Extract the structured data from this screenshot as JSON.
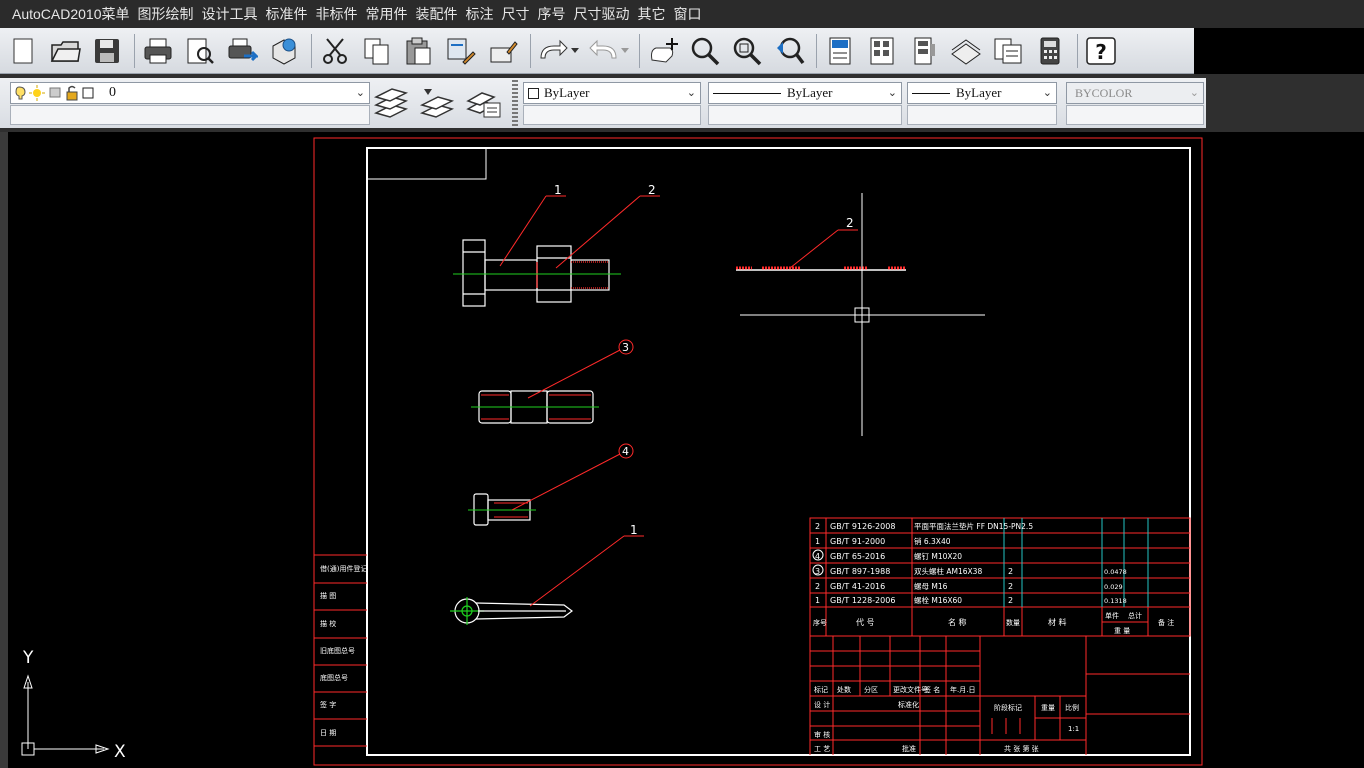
{
  "menu": {
    "items": [
      "AutoCAD2010菜单",
      "图形绘制",
      "设计工具",
      "标准件",
      "非标件",
      "常用件",
      "装配件",
      "标注",
      "尺寸",
      "序号",
      "尺寸驱动",
      "其它",
      "窗口"
    ]
  },
  "layer_toolbar": {
    "layer_value": "0",
    "color_value": "ByLayer",
    "linetype_value": "ByLayer",
    "lineweight_value": "ByLayer",
    "plotstyle_value": "BYCOLOR"
  },
  "drawing": {
    "balloons": {
      "bolt_label": "1",
      "nut_label": "2",
      "washer_label": "2",
      "stud_label": "3",
      "screw_label": "4",
      "pin_label": "1"
    },
    "side_labels": [
      "借(通)用件登记",
      "描 图",
      "描 校",
      "旧底图总号",
      "底图总号",
      "签 字",
      "日 期"
    ],
    "bom_rows": [
      {
        "no": "2",
        "code": "GB/T 9126-2008",
        "name": "平面平面法兰垫片 FF DN15-PN2.5",
        "qty": "",
        "mat": "",
        "unit": ""
      },
      {
        "no": "1",
        "code": "GB/T 91-2000",
        "name": "销 6.3X40",
        "qty": "",
        "mat": "",
        "unit": ""
      },
      {
        "no": "4",
        "code": "GB/T 65-2016",
        "name": "螺钉 M10X20",
        "qty": "",
        "mat": "",
        "unit": ""
      },
      {
        "no": "3",
        "code": "GB/T 897-1988",
        "name": "双头螺柱 AM16X38",
        "qty": "2",
        "mat": "",
        "unit": "0.0478"
      },
      {
        "no": "2",
        "code": "GB/T 41-2016",
        "name": "螺母 M16",
        "qty": "2",
        "mat": "",
        "unit": "0.029"
      },
      {
        "no": "1",
        "code": "GB/T 1228-2006",
        "name": "螺栓 M16X60",
        "qty": "2",
        "mat": "",
        "unit": "0.1318"
      }
    ],
    "bom_header": {
      "no": "序号",
      "code": "代 号",
      "name": "名 称",
      "qty": "数量",
      "mat": "材 料",
      "unit": "单件",
      "total": "总计",
      "weight": "重 量",
      "remark": "备 注"
    },
    "title_block": {
      "row1": [
        "标记",
        "处数",
        "分区",
        "更改文件号",
        "签 名",
        "年.月.日"
      ],
      "design": "设 计",
      "standard": "标准化",
      "check": "审 核",
      "craft": "工 艺",
      "approve": "批准",
      "stage_mark": "阶段标记",
      "weight": "重量",
      "scale": "比例",
      "scale_value": "1:1",
      "sheets": "共  张 第  张"
    },
    "ucs": {
      "x": "X",
      "y": "Y"
    }
  }
}
